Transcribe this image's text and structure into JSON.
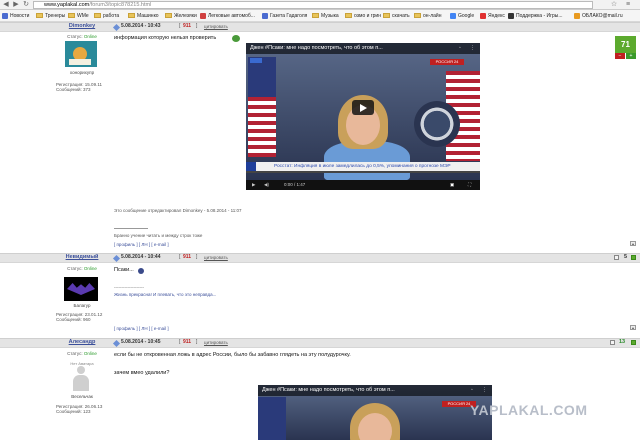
{
  "browser": {
    "url_host": "www.yaplakal.com",
    "url_path": "/forum3/topic878215.html",
    "bookmarks": [
      "Новости",
      "Тренеры",
      "WMe",
      "работа",
      "Машинко",
      "Железяки",
      "Легковые автомоб...",
      "Газета Гадаголя",
      "Музыка",
      "озмо и грин",
      "скачать",
      "он-лайн",
      "Google",
      "Яндекс",
      "Поддержка - Игры...",
      "ОБЛАКО@mail.ru"
    ]
  },
  "posts": [
    {
      "username": "Dimonkey",
      "status_label": "Статус:",
      "status_value": "Online",
      "rank": "хонорихупр",
      "reg": "Регистрация: 15.09.11",
      "msgs": "Сообщений: 373",
      "date": "5.08.2014 - 10:43",
      "num": "911",
      "cite": "цитировать",
      "text": "информация которую нельзя проверить",
      "video_title": "Джен #Псаки: мне надо посмотреть, что об этом п...",
      "ticker": "Росстат: Инфляция в июле замедлилась до 0,5%, упоминания о прогнозе МЭР",
      "channel": "РОССИЯ 24",
      "time": "0:00 / 1:47",
      "edited": "Это сообщение отредактировал Dimonkey - 5.08.2014 - 11:07",
      "sig": "Бранно учение читать и между строк тоже",
      "actions": "[ профиль ] [ ЛН ] [ e-mail ]",
      "rating": "71"
    },
    {
      "username": "Невидимый",
      "status_label": "Статус:",
      "status_value": "Online",
      "rank": "Балагур",
      "reg": "Регистрация: 23.01.12",
      "msgs": "Сообщений: 960",
      "date": "5.08.2014 - 10:44",
      "num": "911",
      "cite": "цитировать",
      "text": "Псаки...",
      "sig_line": "--------------------",
      "sig": "Жизнь прекрасна! И плевать, что это неправда...",
      "actions": "[ профиль ] [ ЛН ] [ e-mail ]",
      "rating": "5"
    },
    {
      "username": "Алесандр",
      "status_label": "Статус:",
      "status_value": "Online",
      "rank": "Весельчак",
      "reg": "Регистрация: 26.06.13",
      "msgs": "Сообщений: 123",
      "avatar_label": "Нет Аватара",
      "date": "5.08.2014 - 10:45",
      "num": "911",
      "cite": "цитировать",
      "text1": "если бы не откровенная ложь в адрес России, было бы забавно глядеть на эту полудурочку.",
      "text2": "зачем вмео удалили?",
      "video_title": "Джен #Псаки: мне надо посмотреть, что об этом п...",
      "rating": "13"
    }
  ],
  "watermark": "YAPLAKAL.COM",
  "colors": {
    "accent": "#3b4f9a",
    "rating_green": "#5caa2e",
    "online": "#2a9a2a"
  }
}
